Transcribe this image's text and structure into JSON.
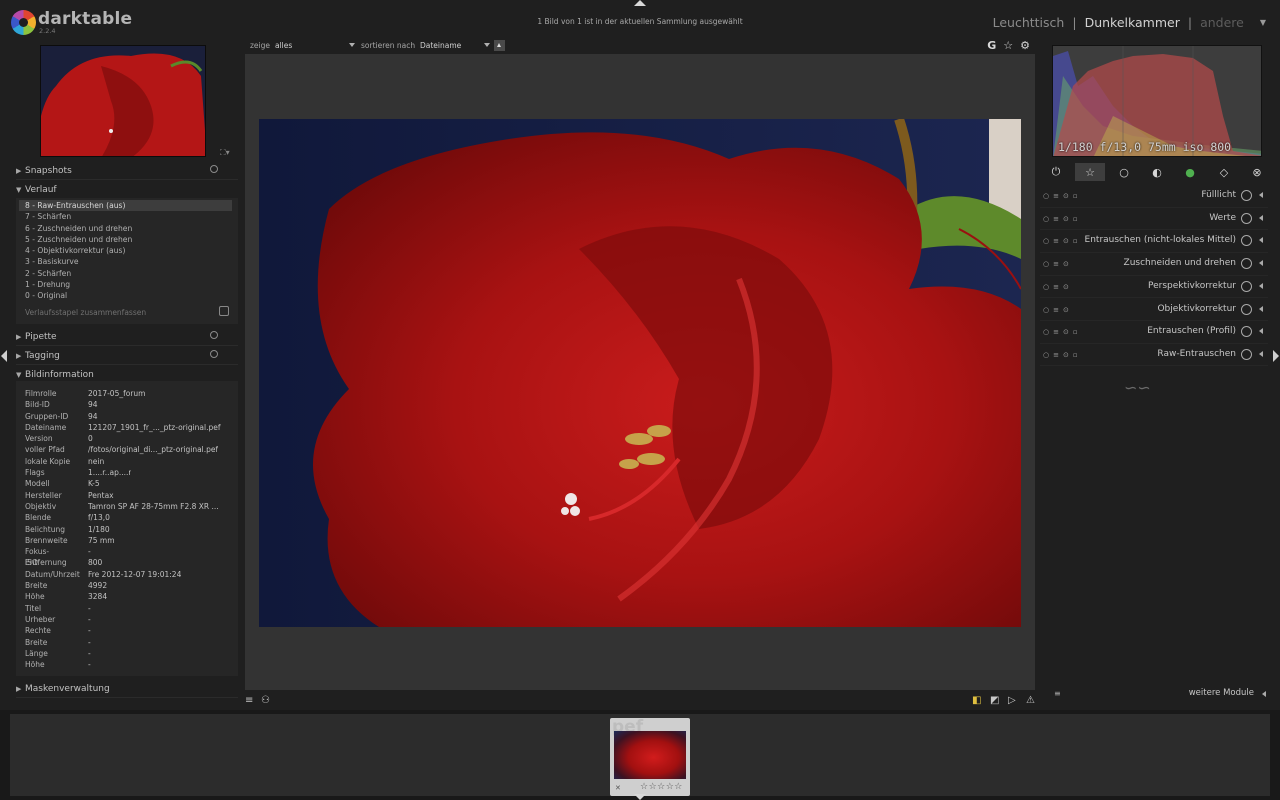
{
  "app": {
    "name": "darktable",
    "version": "2.2.4"
  },
  "header": {
    "selection_info": "1 Bild von 1 ist in der aktuellen Sammlung ausgewählt",
    "views": {
      "lighttable": "Leuchttisch",
      "sep1": "|",
      "darkroom": "Dunkelkammer",
      "sep2": "|",
      "other": "andere"
    }
  },
  "left": {
    "sections": {
      "snapshots": "Snapshots",
      "history": "Verlauf",
      "color_picker": "Pipette",
      "tagging": "Tagging",
      "image_info": "Bildinformation",
      "masks": "Maskenverwaltung"
    },
    "history_items": [
      "8 - Raw-Entrauschen (aus)",
      "7 - Schärfen",
      "6 - Zuschneiden und drehen",
      "5 - Zuschneiden und drehen",
      "4 - Objektivkorrektur (aus)",
      "3 - Basiskurve",
      "2 - Schärfen",
      "1 - Drehung",
      "0 - Original"
    ],
    "history_compress": "Verlaufsstapel zusammenfassen",
    "image_info": [
      {
        "k": "Filmrolle",
        "v": "2017-05_forum"
      },
      {
        "k": "Bild-ID",
        "v": "94"
      },
      {
        "k": "Gruppen-ID",
        "v": "94"
      },
      {
        "k": "Dateiname",
        "v": "121207_1901_fr_..._ptz-original.pef"
      },
      {
        "k": "Version",
        "v": "0"
      },
      {
        "k": "voller Pfad",
        "v": "/fotos/original_di..._ptz-original.pef"
      },
      {
        "k": "lokale Kopie",
        "v": "nein"
      },
      {
        "k": "Flags",
        "v": "1....r..ap....r"
      },
      {
        "k": "Modell",
        "v": "K-5"
      },
      {
        "k": "Hersteller",
        "v": "Pentax"
      },
      {
        "k": "Objektiv",
        "v": "Tamron SP AF 28-75mm F2.8 XR ..."
      },
      {
        "k": "Blende",
        "v": "f/13,0"
      },
      {
        "k": "Belichtung",
        "v": "1/180"
      },
      {
        "k": "Brennweite",
        "v": "75 mm"
      },
      {
        "k": "Fokus-Entfernung",
        "v": "-"
      },
      {
        "k": "ISO",
        "v": "800"
      },
      {
        "k": "Datum/Uhrzeit",
        "v": "Fre 2012-12-07 19:01:24"
      },
      {
        "k": "Breite",
        "v": "4992"
      },
      {
        "k": "Höhe",
        "v": "3284"
      },
      {
        "k": "Titel",
        "v": "-"
      },
      {
        "k": "Urheber",
        "v": "-"
      },
      {
        "k": "Rechte",
        "v": "-"
      },
      {
        "k": "Breite",
        "v": "-"
      },
      {
        "k": "Länge",
        "v": "-"
      },
      {
        "k": "Höhe",
        "v": "-"
      }
    ]
  },
  "center": {
    "filter": {
      "show_label": "zeige",
      "show_value": "alles",
      "sort_label": "sortieren nach",
      "sort_value": "Dateiname"
    },
    "top_icons": {
      "grouping": "G",
      "star": "☆",
      "gear": "⚙"
    }
  },
  "right": {
    "histogram_exif": "1/180 f/13,0 75mm iso 800",
    "modules": [
      {
        "name": "Fülllicht",
        "icon": "fill-light-icon"
      },
      {
        "name": "Werte",
        "icon": "levels-icon"
      },
      {
        "name": "Entrauschen (nicht-lokales Mittel)",
        "icon": "denoise-nlm-icon"
      },
      {
        "name": "Zuschneiden und drehen",
        "icon": "crop-rotate-icon"
      },
      {
        "name": "Perspektivkorrektur",
        "icon": "perspective-icon"
      },
      {
        "name": "Objektivkorrektur",
        "icon": "lens-icon"
      },
      {
        "name": "Entrauschen (Profil)",
        "icon": "denoise-profile-icon"
      },
      {
        "name": "Raw-Entrauschen",
        "icon": "raw-denoise-icon"
      }
    ],
    "more_modules": "weitere Module"
  },
  "filmstrip": {
    "ext": "pef",
    "stars": "☆☆☆☆☆"
  },
  "colors": {
    "accent_red": "#b01414",
    "panel_bg": "#262626",
    "canvas_bg": "#333333"
  }
}
